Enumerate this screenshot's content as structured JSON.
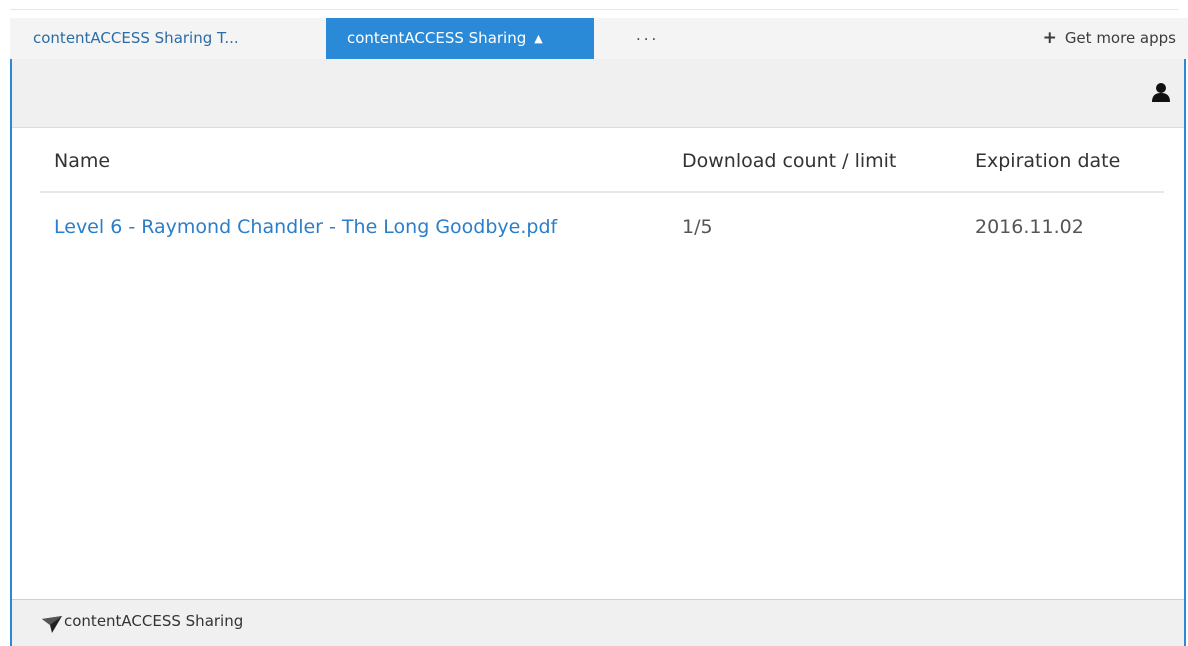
{
  "tabs": [
    {
      "label": "contentACCESS Sharing T..."
    },
    {
      "label": "contentACCESS Sharing",
      "active": true,
      "icon": "chevron-up-icon"
    },
    {
      "label": "..."
    }
  ],
  "get_more_apps": {
    "label": "Get more apps",
    "icon": "plus-icon"
  },
  "header": {
    "icon": "user-icon"
  },
  "table": {
    "columns": [
      "Name",
      "Download count / limit",
      "Expiration date"
    ],
    "rows": [
      {
        "name": "Level 6 - Raymond Chandler - The Long Goodbye.pdf",
        "download": "1/5",
        "expiration": "2016.11.02"
      }
    ]
  },
  "footer": {
    "label": "contentACCESS Sharing",
    "icon": "paper-plane-icon"
  },
  "colors": {
    "accent": "#2a8ad8",
    "link": "#2b7ec9"
  }
}
